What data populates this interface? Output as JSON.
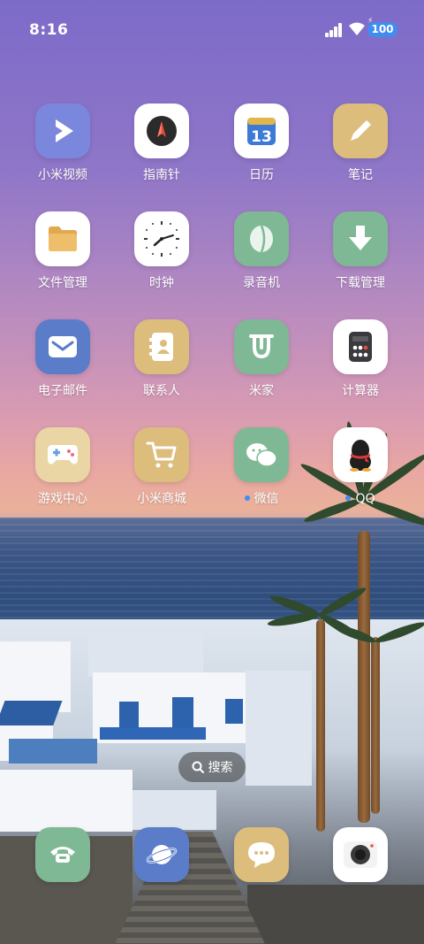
{
  "status_bar": {
    "time": "8:16",
    "battery": "100"
  },
  "apps": [
    {
      "label": "小米视频",
      "icon": "play-icon",
      "color": "#7b86dd"
    },
    {
      "label": "指南针",
      "icon": "compass-icon",
      "color": "#ffffff"
    },
    {
      "label": "日历",
      "icon": "calendar-icon",
      "color": "#ffffff",
      "day": "13"
    },
    {
      "label": "笔记",
      "icon": "pencil-icon",
      "color": "#dcbd7c"
    },
    {
      "label": "文件管理",
      "icon": "folder-icon",
      "color": "#ffffff"
    },
    {
      "label": "时钟",
      "icon": "clock-icon",
      "color": "#ffffff"
    },
    {
      "label": "录音机",
      "icon": "recorder-icon",
      "color": "#7fb894"
    },
    {
      "label": "下载管理",
      "icon": "download-icon",
      "color": "#7fb894"
    },
    {
      "label": "电子邮件",
      "icon": "mail-icon",
      "color": "#5a7cc9"
    },
    {
      "label": "联系人",
      "icon": "contacts-icon",
      "color": "#dcbd7c"
    },
    {
      "label": "米家",
      "icon": "mijia-icon",
      "color": "#7fb894"
    },
    {
      "label": "计算器",
      "icon": "calculator-icon",
      "color": "#ffffff"
    },
    {
      "label": "游戏中心",
      "icon": "gamepad-icon",
      "color": "#ead6a4"
    },
    {
      "label": "小米商城",
      "icon": "cart-icon",
      "color": "#dcbd7c"
    },
    {
      "label": "微信",
      "icon": "wechat-icon",
      "color": "#7fb894",
      "badge": true
    },
    {
      "label": "QQ",
      "icon": "qq-penguin-icon",
      "color": "#ffffff",
      "badge": true
    }
  ],
  "search": {
    "label": "搜索"
  },
  "dock": [
    {
      "name": "phone",
      "icon": "phone-icon",
      "color": "#7fb894"
    },
    {
      "name": "browser",
      "icon": "browser-planet-icon",
      "color": "#5a7cc9"
    },
    {
      "name": "messages",
      "icon": "message-bubble-icon",
      "color": "#dcbd7c"
    },
    {
      "name": "camera",
      "icon": "camera-icon",
      "color": "#ffffff"
    }
  ]
}
